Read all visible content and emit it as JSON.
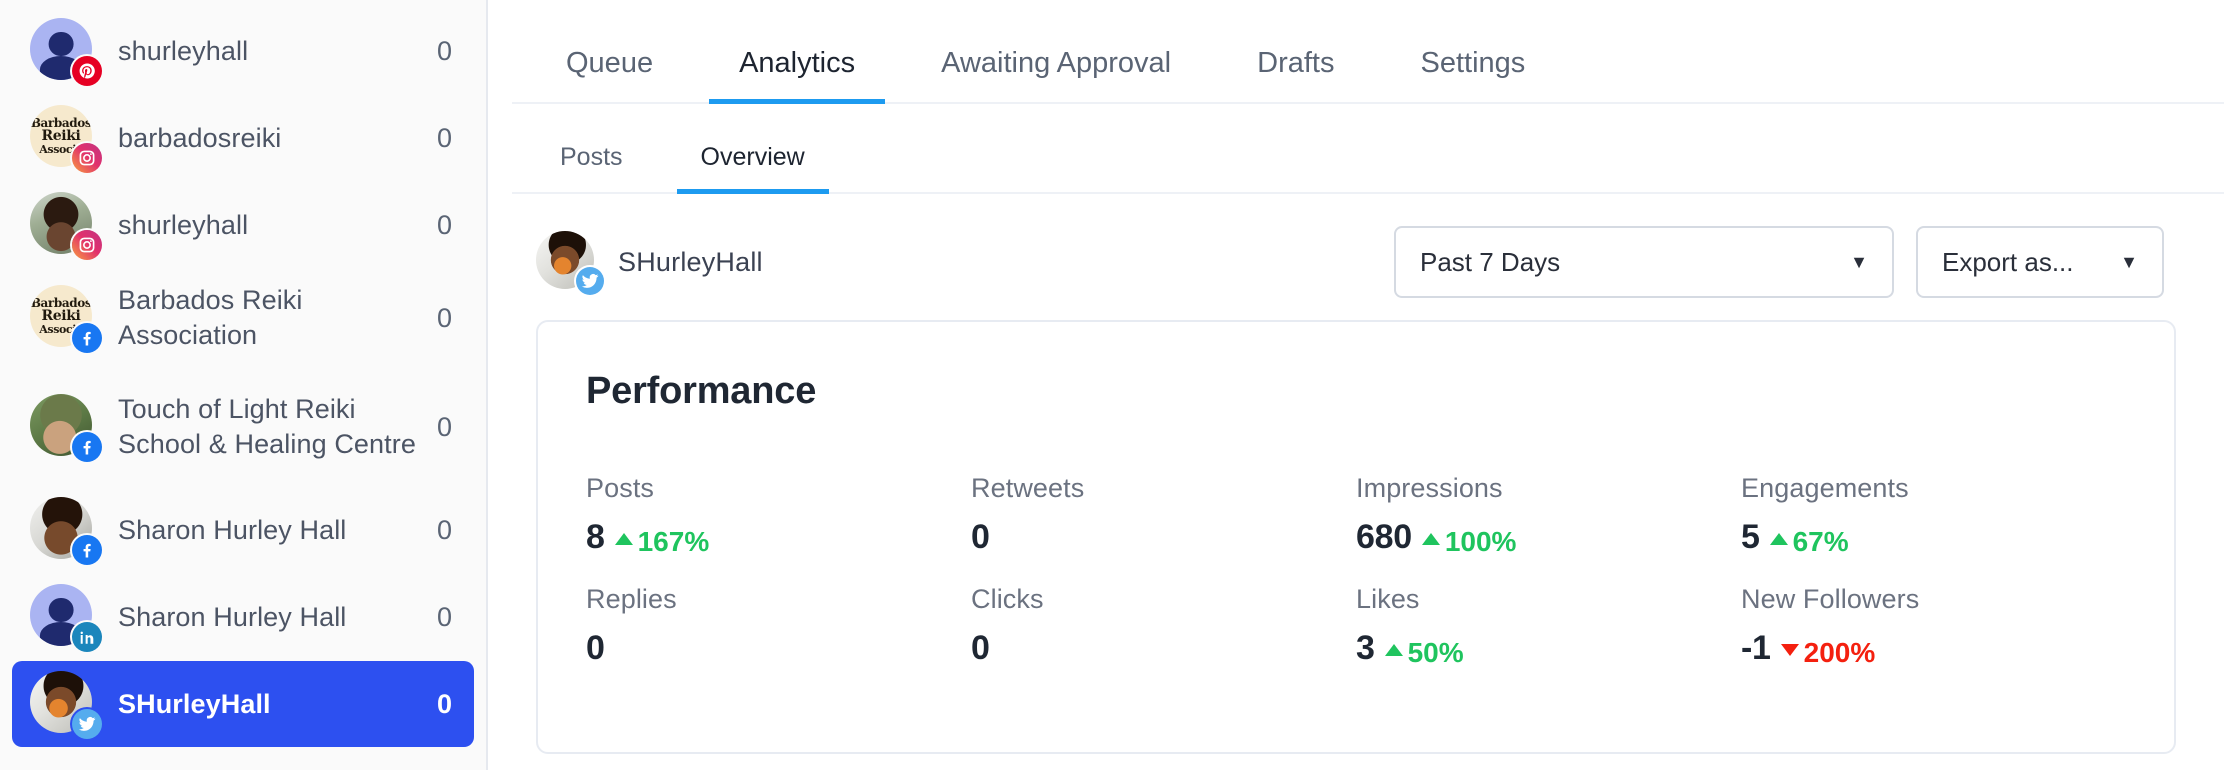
{
  "sidebar": {
    "accounts": [
      {
        "name": "shurleyhall",
        "count": "0",
        "network": "pinterest",
        "avatar": "person",
        "selected": false,
        "lines": 1
      },
      {
        "name": "barbadosreiki",
        "count": "0",
        "network": "instagram",
        "avatar": "logo",
        "selected": false,
        "lines": 1
      },
      {
        "name": "shurleyhall",
        "count": "0",
        "network": "instagram",
        "avatar": "photoA",
        "selected": false,
        "lines": 1
      },
      {
        "name": "Barbados Reiki Association",
        "count": "0",
        "network": "facebook",
        "avatar": "logo",
        "selected": false,
        "lines": 2
      },
      {
        "name": "Touch of Light Reiki School & Healing Centre",
        "count": "0",
        "network": "facebook",
        "avatar": "photoC",
        "selected": false,
        "lines": 3
      },
      {
        "name": "Sharon Hurley Hall",
        "count": "0",
        "network": "facebook",
        "avatar": "photoD",
        "selected": false,
        "lines": 1
      },
      {
        "name": "Sharon Hurley Hall",
        "count": "0",
        "network": "linkedin",
        "avatar": "person",
        "selected": false,
        "lines": 1
      },
      {
        "name": "SHurleyHall",
        "count": "0",
        "network": "twitter",
        "avatar": "photoE",
        "selected": true,
        "lines": 1
      }
    ],
    "logo_text": {
      "line1": "Barbados",
      "line2": "Reiki",
      "line3": "Associa"
    }
  },
  "tabs": {
    "primary": [
      {
        "label": "Queue",
        "active": false
      },
      {
        "label": "Analytics",
        "active": true
      },
      {
        "label": "Awaiting Approval",
        "active": false
      },
      {
        "label": "Drafts",
        "active": false
      },
      {
        "label": "Settings",
        "active": false
      }
    ],
    "secondary": [
      {
        "label": "Posts",
        "active": false
      },
      {
        "label": "Overview",
        "active": true
      }
    ]
  },
  "toolbar": {
    "profile_name": "SHurleyHall",
    "profile_network": "twitter",
    "date_range": "Past 7 Days",
    "export_label": "Export as...",
    "caret_icon": "chevron-down-icon"
  },
  "performance": {
    "title": "Performance",
    "metrics": [
      {
        "label": "Posts",
        "value": "8",
        "delta": "167%",
        "direction": "up"
      },
      {
        "label": "Retweets",
        "value": "0",
        "delta": "",
        "direction": "none"
      },
      {
        "label": "Impressions",
        "value": "680",
        "delta": "100%",
        "direction": "up"
      },
      {
        "label": "Engagements",
        "value": "5",
        "delta": "67%",
        "direction": "up"
      },
      {
        "label": "Replies",
        "value": "0",
        "delta": "",
        "direction": "none"
      },
      {
        "label": "Clicks",
        "value": "0",
        "delta": "",
        "direction": "none"
      },
      {
        "label": "Likes",
        "value": "3",
        "delta": "50%",
        "direction": "up"
      },
      {
        "label": "New Followers",
        "value": "-1",
        "delta": "200%",
        "direction": "down"
      }
    ]
  },
  "colors": {
    "accent_blue": "#2d50f0",
    "tab_underline": "#1d9bf0",
    "positive": "#1fc45e",
    "negative": "#f4200f",
    "text_dark": "#1f2733",
    "text_muted": "#6b7280"
  }
}
